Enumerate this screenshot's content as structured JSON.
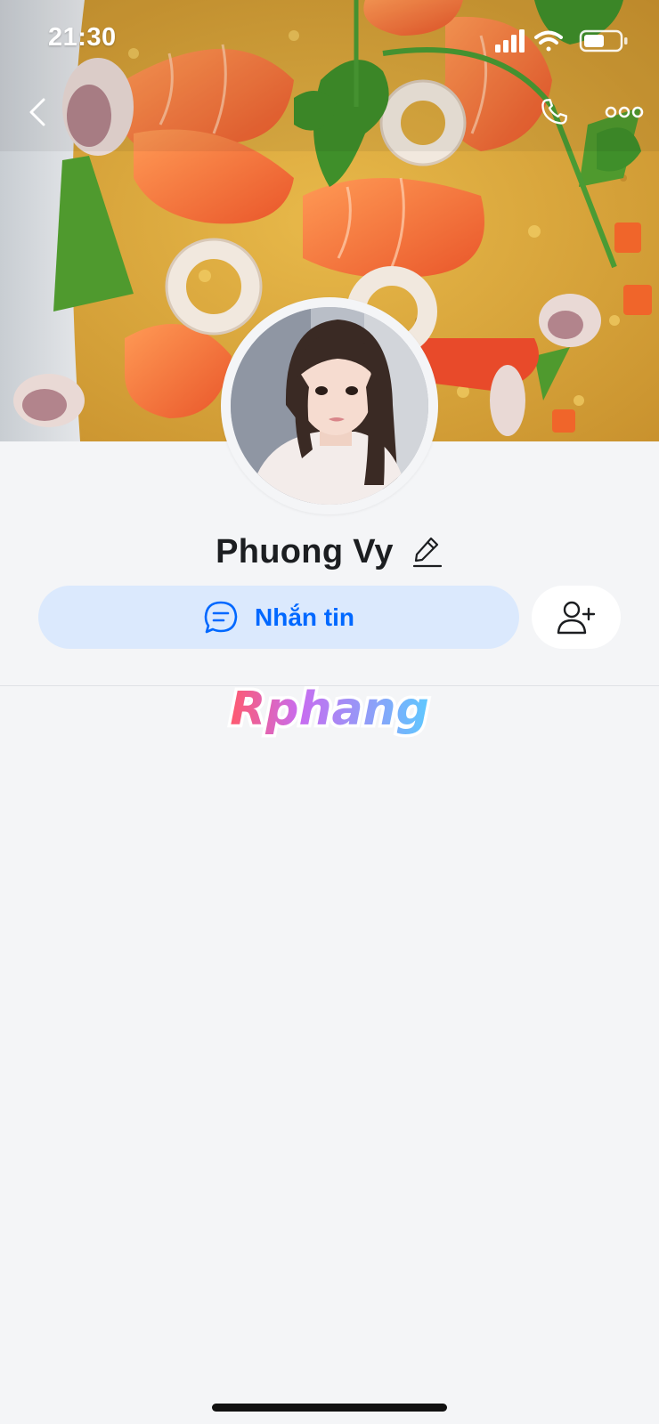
{
  "status_bar": {
    "time": "21:30",
    "signal_icon": "cellular-signal-icon",
    "wifi_icon": "wifi-icon",
    "battery_icon": "battery-icon"
  },
  "nav": {
    "back_icon": "chevron-left-icon",
    "call_icon": "phone-icon",
    "more_icon": "more-dots-icon"
  },
  "profile": {
    "name": "Phuong Vy",
    "edit_icon": "pencil-icon"
  },
  "actions": {
    "message_label": "Nhắn tin",
    "message_icon": "chat-bubble-icon",
    "add_friend_icon": "add-user-icon"
  },
  "watermark": {
    "text": "Rphang"
  },
  "colors": {
    "accent": "#0068ff",
    "message_button_bg": "#dbe9fd",
    "page_bg": "#f4f5f7",
    "name_text": "#1c1e21"
  }
}
